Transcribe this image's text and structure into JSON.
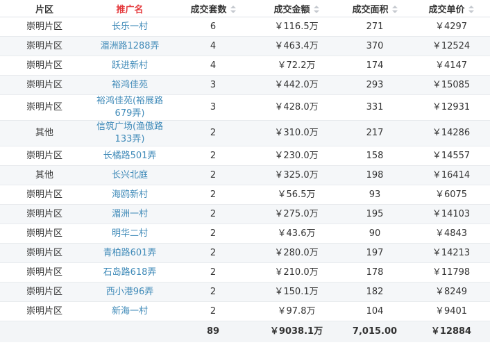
{
  "headers": {
    "district": "片区",
    "name": "推广名",
    "count": "成交套数",
    "amount": "成交金额",
    "area": "成交面积",
    "price": "成交单价"
  },
  "rows": [
    {
      "district": "崇明片区",
      "name": "长乐一村",
      "count": "6",
      "amount": "￥116.5万",
      "area": "271",
      "price": "￥4297"
    },
    {
      "district": "崇明片区",
      "name": "湄洲路1288弄",
      "count": "4",
      "amount": "￥463.4万",
      "area": "370",
      "price": "￥12524"
    },
    {
      "district": "崇明片区",
      "name": "跃进新村",
      "count": "4",
      "amount": "￥72.2万",
      "area": "174",
      "price": "￥4147"
    },
    {
      "district": "崇明片区",
      "name": "裕鸿佳苑",
      "count": "3",
      "amount": "￥442.0万",
      "area": "293",
      "price": "￥15085"
    },
    {
      "district": "崇明片区",
      "name": "裕鸿佳苑(裕展路679弄)",
      "count": "3",
      "amount": "￥428.0万",
      "area": "331",
      "price": "￥12931"
    },
    {
      "district": "其他",
      "name": "信筑广场(渔傲路133弄)",
      "count": "2",
      "amount": "￥310.0万",
      "area": "217",
      "price": "￥14286"
    },
    {
      "district": "崇明片区",
      "name": "长橘路501弄",
      "count": "2",
      "amount": "￥230.0万",
      "area": "158",
      "price": "￥14557"
    },
    {
      "district": "其他",
      "name": "长兴北庭",
      "count": "2",
      "amount": "￥325.0万",
      "area": "198",
      "price": "￥16414"
    },
    {
      "district": "崇明片区",
      "name": "海鸥新村",
      "count": "2",
      "amount": "￥56.5万",
      "area": "93",
      "price": "￥6075"
    },
    {
      "district": "崇明片区",
      "name": "湄洲一村",
      "count": "2",
      "amount": "￥275.0万",
      "area": "195",
      "price": "￥14103"
    },
    {
      "district": "崇明片区",
      "name": "明华二村",
      "count": "2",
      "amount": "￥43.6万",
      "area": "90",
      "price": "￥4843"
    },
    {
      "district": "崇明片区",
      "name": "青柏路601弄",
      "count": "2",
      "amount": "￥280.0万",
      "area": "197",
      "price": "￥14213"
    },
    {
      "district": "崇明片区",
      "name": "石岛路618弄",
      "count": "2",
      "amount": "￥210.0万",
      "area": "178",
      "price": "￥11798"
    },
    {
      "district": "崇明片区",
      "name": "西小港96弄",
      "count": "2",
      "amount": "￥150.1万",
      "area": "182",
      "price": "￥8249"
    },
    {
      "district": "崇明片区",
      "name": "新海一村",
      "count": "2",
      "amount": "￥97.8万",
      "area": "104",
      "price": "￥9401"
    }
  ],
  "totals": {
    "district": "",
    "name": "",
    "count": "89",
    "amount": "￥9038.1万",
    "area": "7,015.00",
    "price": "￥12884"
  },
  "colors": {
    "active_header": "#e4393c",
    "link": "#3f8ab8",
    "alt_row": "#f5f7f9"
  }
}
